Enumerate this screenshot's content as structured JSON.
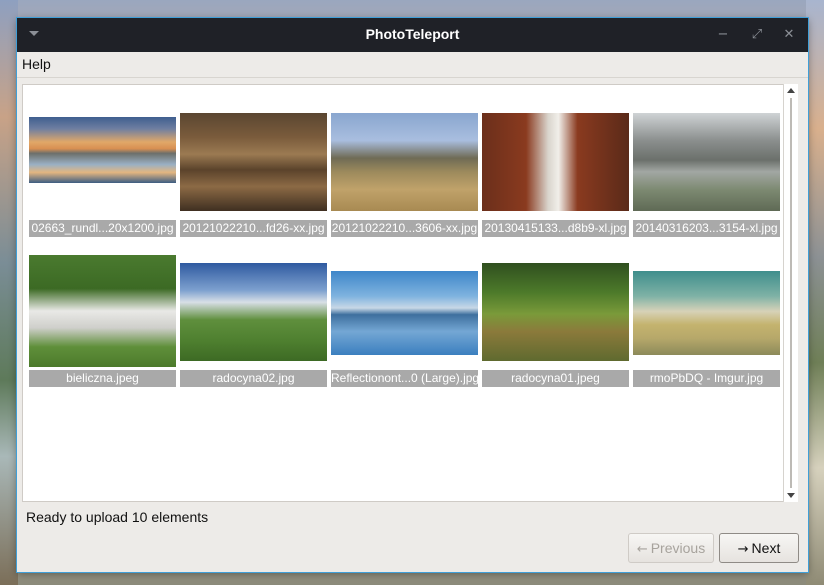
{
  "window": {
    "title": "PhotoTeleport"
  },
  "menu": {
    "help": "Help"
  },
  "gallery": {
    "items": [
      {
        "caption": "02663_rundl...20x1200.jpg"
      },
      {
        "caption": "20121022210...fd26-xx.jpg"
      },
      {
        "caption": "20121022210...3606-xx.jpg"
      },
      {
        "caption": "20130415133...d8b9-xl.jpg"
      },
      {
        "caption": "20140316203...3154-xl.jpg"
      },
      {
        "caption": "bieliczna.jpeg"
      },
      {
        "caption": "radocyna02.jpg"
      },
      {
        "caption": "Reflectionont...0 (Large).jpg"
      },
      {
        "caption": "radocyna01.jpeg"
      },
      {
        "caption": "rmoPbDQ - Imgur.jpg"
      }
    ]
  },
  "status": {
    "text": "Ready to upload 10 elements"
  },
  "buttons": {
    "previous": "Previous",
    "next": "Next"
  },
  "icons": {
    "menu": "chevron-down-icon",
    "minimize": "minimize-icon",
    "maximize": "maximize-icon",
    "close": "close-icon"
  }
}
